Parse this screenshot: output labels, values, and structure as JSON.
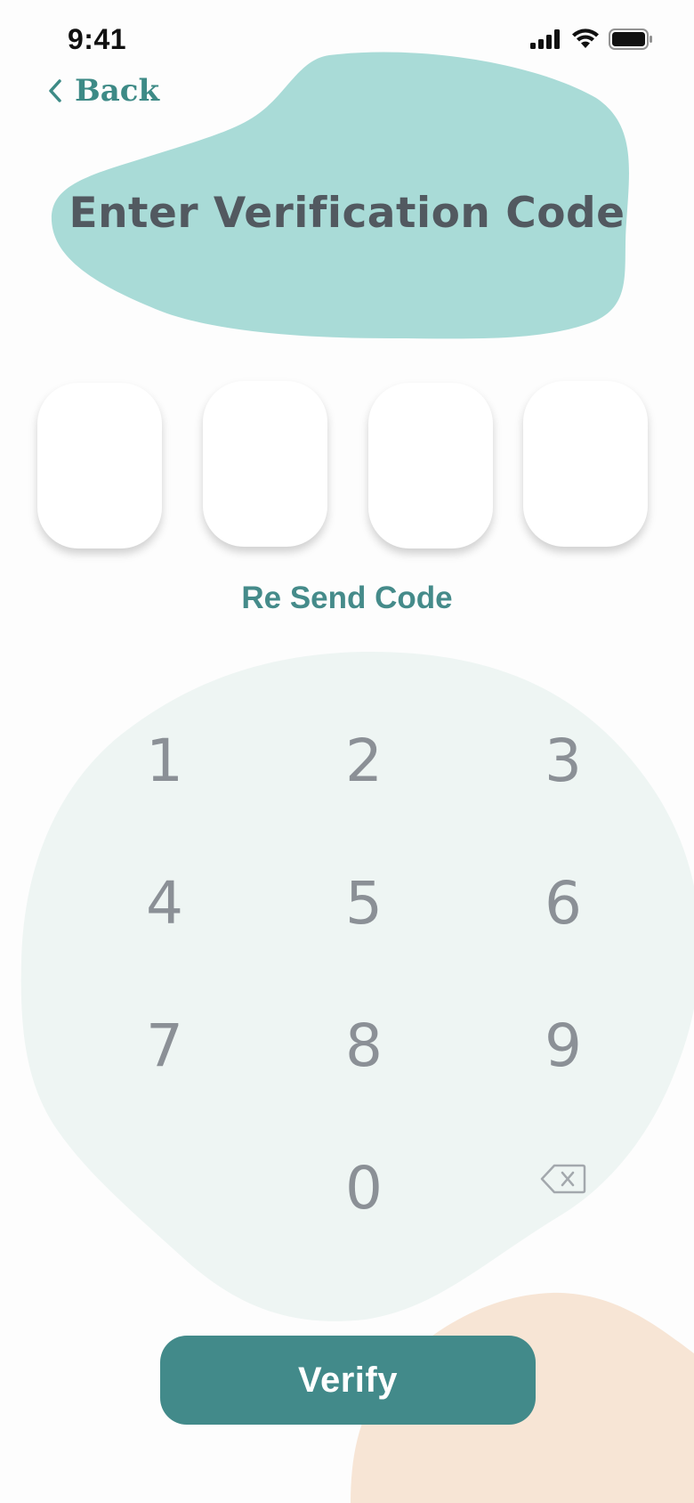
{
  "status_bar": {
    "time": "9:41"
  },
  "nav": {
    "back_label": "Back"
  },
  "header": {
    "title": "Enter Verification Code"
  },
  "code_inputs": [
    {
      "value": ""
    },
    {
      "value": ""
    },
    {
      "value": ""
    },
    {
      "value": ""
    }
  ],
  "resend": {
    "label": "Re Send Code"
  },
  "keypad": {
    "keys": [
      "1",
      "2",
      "3",
      "4",
      "5",
      "6",
      "7",
      "8",
      "9",
      "0"
    ],
    "backspace_icon": "backspace-icon"
  },
  "actions": {
    "verify_label": "Verify"
  },
  "colors": {
    "accent": "#428a8a",
    "title_blob": "#a9dbd7",
    "keypad_blob": "#eef5f3",
    "corner_blob": "#f7e5d5",
    "title_text": "#525960",
    "key_text": "#8b9096"
  }
}
